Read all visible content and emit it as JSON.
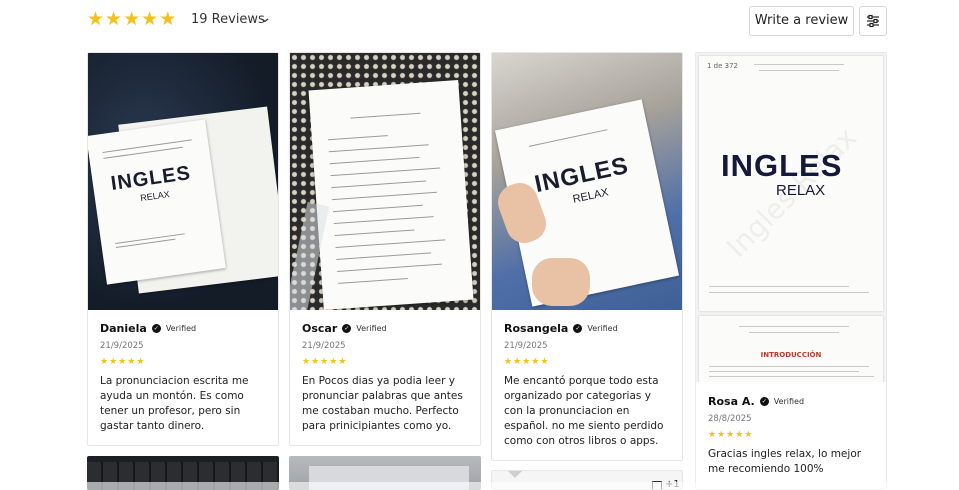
{
  "header": {
    "stars": [
      "★",
      "★",
      "★",
      "★",
      "★"
    ],
    "reviews_count": "19 Reviews",
    "write_review_label": "Write a review"
  },
  "colors": {
    "star": "#f2c21b",
    "text": "#1f1f1f",
    "border": "#d6d6d6"
  },
  "reviews": [
    {
      "name": "Daniela",
      "verified": "Verified",
      "date": "21/9/2025",
      "text": "La pronunciacion escrita me ayuda un montón. Es como tener un profesor, pero sin gastar tanto dinero."
    },
    {
      "name": "Oscar",
      "verified": "Verified",
      "date": "21/9/2025",
      "text": "En Pocos dias ya podia leer y pronunciar palabras que antes me costaban mucho. Perfecto para prinicipiantes como yo."
    },
    {
      "name": "Rosangela",
      "verified": "Verified",
      "date": "21/9/2025",
      "text": "Me encantó porque todo esta organizado por categorias y con la pronunciacion en español. no me siento perdido como con otros libros o apps."
    },
    {
      "name": "Rosa A.",
      "verified": "Verified",
      "date": "28/8/2025",
      "text": "Gracias ingles relax, lo mejor me recomiendo 100%"
    }
  ],
  "book": {
    "title": "INGLES",
    "subtitle": "RELAX",
    "page_indicator": "1 de 372",
    "watermark": "Ingles Relax",
    "section_title": "INTRODUCCIÓN",
    "badge": "+1"
  }
}
